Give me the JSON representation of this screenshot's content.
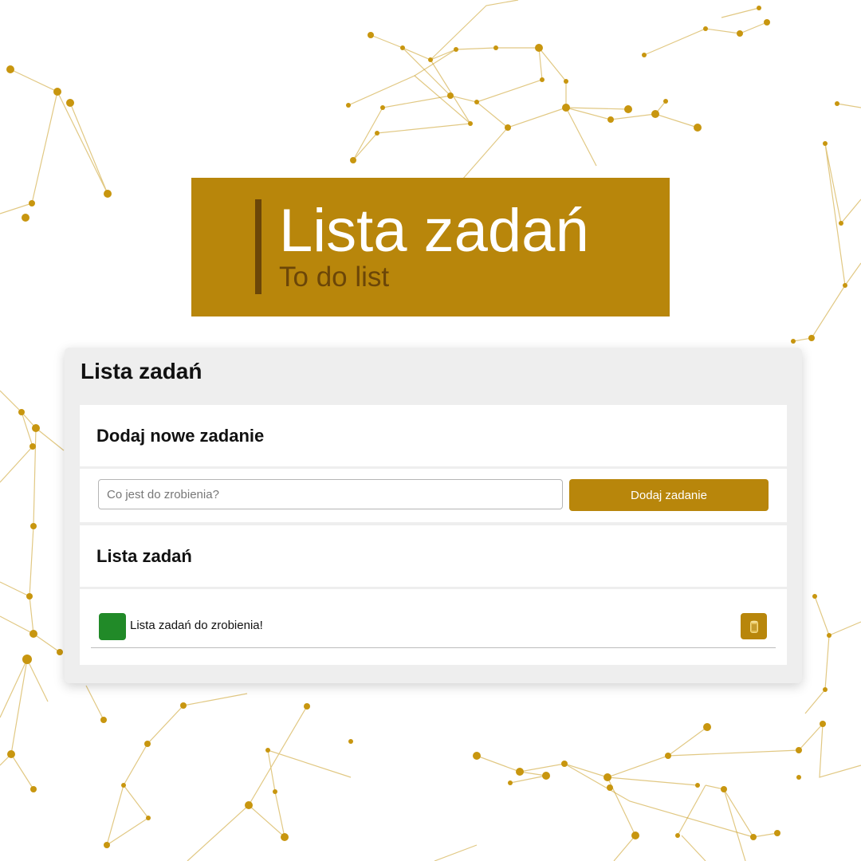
{
  "banner": {
    "title": "Lista zadań",
    "subtitle": "To do list"
  },
  "app": {
    "title": "Lista zadań",
    "add_section": {
      "heading": "Dodaj nowe zadanie",
      "input_placeholder": "Co jest do zrobienia?",
      "input_value": "",
      "button_label": "Dodaj zadanie"
    },
    "list_section": {
      "heading": "Lista zadań",
      "tasks": [
        {
          "text": "Lista zadań do zrobienia!",
          "done": false
        }
      ]
    }
  },
  "colors": {
    "accent": "#b8860b",
    "accent_dark": "#6b4608",
    "done_button": "#218a28",
    "panel_bg": "#eeeeee"
  },
  "icons": {
    "delete": "trash-icon",
    "done": "checkbox-icon"
  }
}
